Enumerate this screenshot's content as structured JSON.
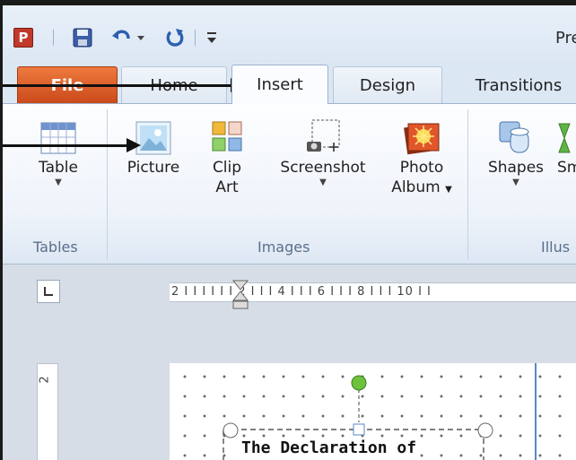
{
  "window": {
    "app_logo": "P",
    "title_fragment": "Pre"
  },
  "tabs": [
    {
      "label": "File"
    },
    {
      "label": "Home"
    },
    {
      "label": "Insert"
    },
    {
      "label": "Design"
    },
    {
      "label": "Transitions"
    }
  ],
  "active_tab": "Insert",
  "ribbon": {
    "tables_group": {
      "label": "Tables",
      "table_button": "Table"
    },
    "images_group": {
      "label": "Images",
      "picture_button": "Picture",
      "clipart_button_line1": "Clip",
      "clipart_button_line2": "Art",
      "screenshot_button": "Screenshot",
      "photoalbum_line1": "Photo",
      "photoalbum_line2": "Album"
    },
    "illustrations_group": {
      "label": "Illus",
      "shapes_button": "Shapes",
      "smartart_button": "Sm"
    }
  },
  "rulers": {
    "horizontal": "2 I I I  I I I 2 I I I 4 I I I 6 I I I 8 I I I 10 I I",
    "vertical_label": "2"
  },
  "slide": {
    "textbox_text": "The Declaration of"
  },
  "icons": {
    "app": "powerpoint-logo-icon",
    "save": "save-icon",
    "undo": "undo-icon",
    "redo": "redo-icon",
    "customize": "customize-qat-icon",
    "table": "table-icon",
    "picture": "picture-icon",
    "clipart": "clipart-icon",
    "screenshot": "screenshot-icon",
    "photoalbum": "photo-album-icon",
    "shapes": "shapes-icon",
    "smartart": "smartart-icon",
    "tab_selector": "tab-selector-icon"
  },
  "colors": {
    "file_tab": "#d0501f",
    "ribbon_bg": "#eef3fa",
    "guide_line": "#5b86c4",
    "rotate_handle": "#6cc23a"
  }
}
